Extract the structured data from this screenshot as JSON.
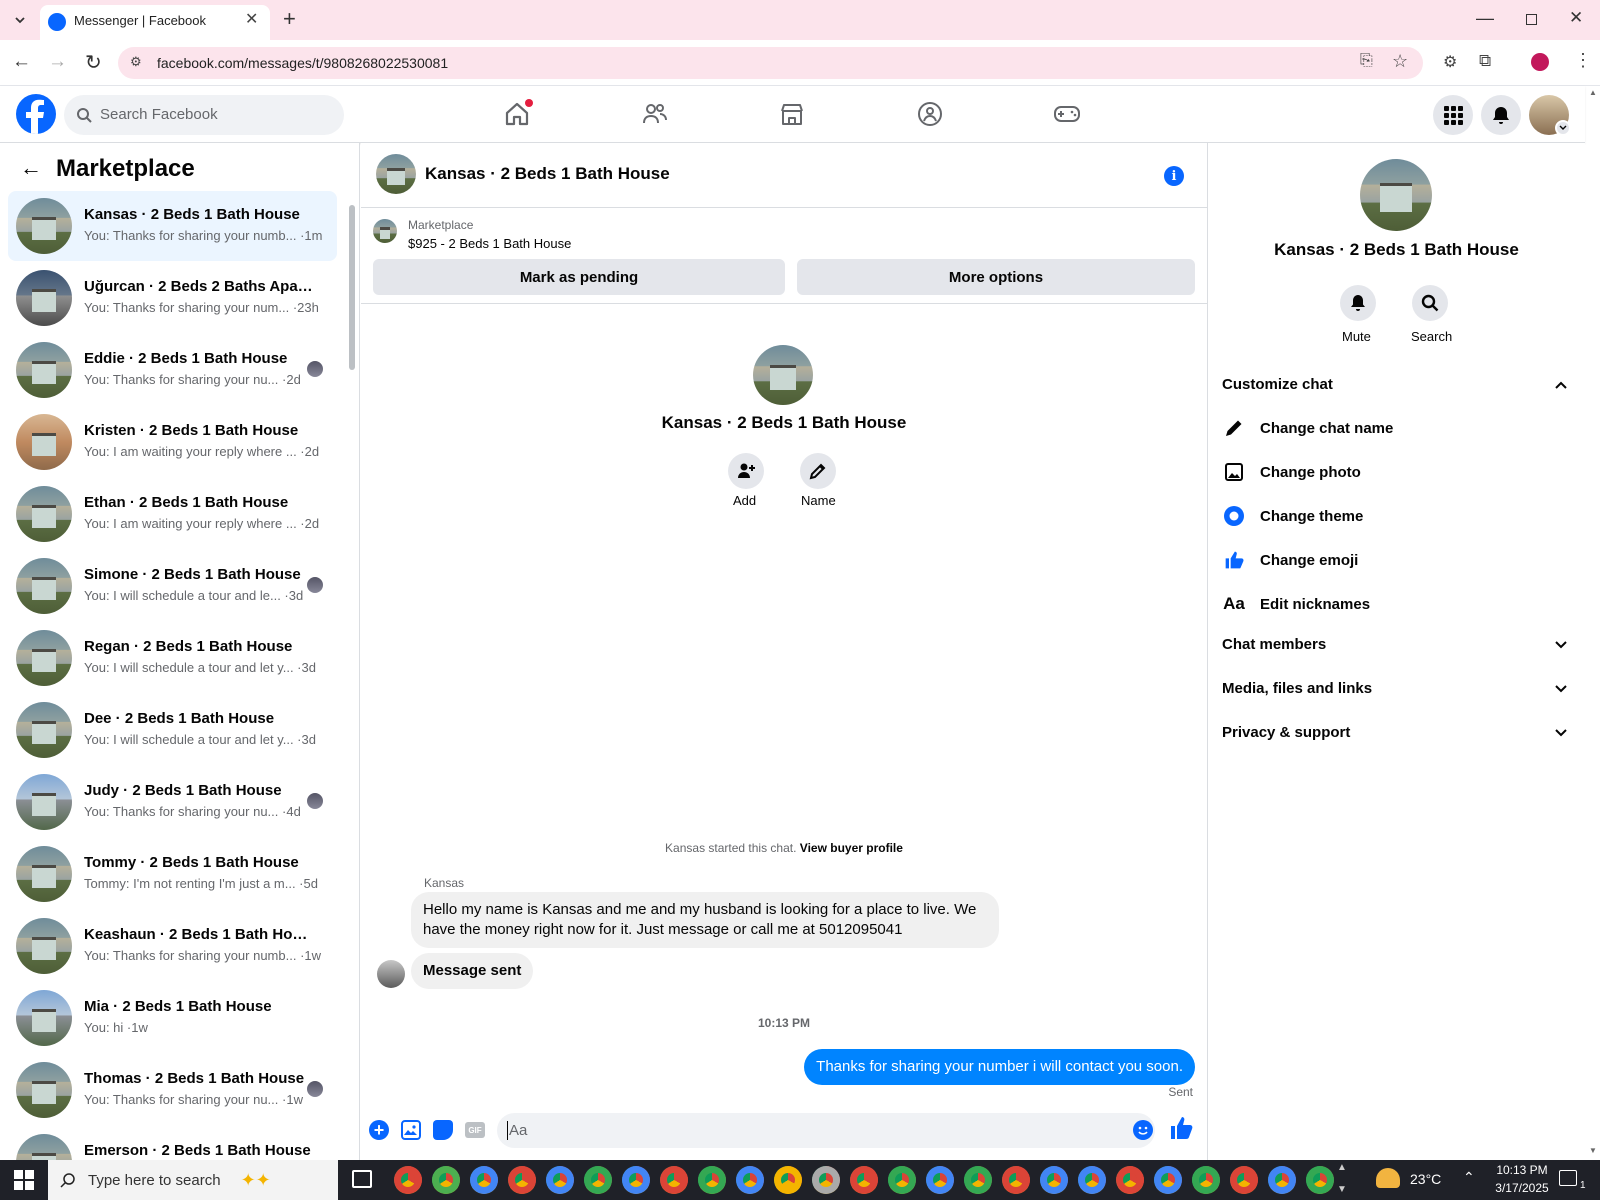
{
  "browser": {
    "tab_title": "Messenger | Facebook",
    "url": "facebook.com/messages/t/9808268022530081"
  },
  "fb": {
    "search_placeholder": "Search Facebook"
  },
  "left": {
    "title": "Marketplace",
    "conversations": [
      {
        "name": "Kansas · 2 Beds 1 Bath House",
        "preview": "You: Thanks for sharing your numb... ·1m",
        "active": true
      },
      {
        "name": "Uğurcan · 2 Beds 2 Baths Apart...",
        "preview": "You: Thanks for sharing your num... ·23h"
      },
      {
        "name": "Eddie · 2 Beds 1 Bath House",
        "preview": "You: Thanks for sharing your nu... ·2d"
      },
      {
        "name": "Kristen · 2 Beds 1 Bath House",
        "preview": "You: I am waiting your reply where ... ·2d"
      },
      {
        "name": "Ethan · 2 Beds 1 Bath House",
        "preview": "You: I am waiting your reply where ... ·2d"
      },
      {
        "name": "Simone · 2 Beds 1 Bath House",
        "preview": "You: I will schedule a tour and le... ·3d"
      },
      {
        "name": "Regan · 2 Beds 1 Bath House",
        "preview": "You: I will schedule a tour and let y... ·3d"
      },
      {
        "name": "Dee · 2 Beds 1 Bath House",
        "preview": "You: I will schedule a tour and let y... ·3d"
      },
      {
        "name": "Judy · 2 Beds 1 Bath House",
        "preview": "You: Thanks for sharing your nu... ·4d"
      },
      {
        "name": "Tommy · 2 Beds 1 Bath House",
        "preview": "Tommy: I'm not renting I'm just a m... ·5d"
      },
      {
        "name": "Keashaun · 2 Beds 1 Bath House",
        "preview": "You: Thanks for sharing your numb... ·1w"
      },
      {
        "name": "Mia · 2 Beds 1 Bath House",
        "preview": "You: hi ·1w"
      },
      {
        "name": "Thomas · 2 Beds 1 Bath House",
        "preview": "You: Thanks for sharing your nu... ·1w"
      },
      {
        "name": "Emerson · 2 Beds 1 Bath House",
        "preview": ""
      }
    ]
  },
  "chat": {
    "header_title": "Kansas · 2 Beds 1 Bath House",
    "listing_source": "Marketplace",
    "listing_title": "$925 - 2 Beds 1 Bath House",
    "mark_pending": "Mark as pending",
    "more_options": "More options",
    "intro_name": "Kansas · 2 Beds 1 Bath House",
    "add_label": "Add",
    "name_label": "Name",
    "started_text": "Kansas started this chat.",
    "view_buyer": "View buyer profile",
    "sender_name": "Kansas",
    "msg1": "Hello my name is Kansas and me and my husband is looking for a place to live. We have the money right now for it. Just message or call me at 5012095041",
    "msg2": "Message sent",
    "timestamp": "10:13 PM",
    "msg3": "Thanks for sharing your number i will contact you soon.",
    "status": "Sent",
    "composer_placeholder": "Aa",
    "gif_label": "GIF"
  },
  "right": {
    "title": "Kansas · 2 Beds 1 Bath House",
    "mute": "Mute",
    "search": "Search",
    "customize": "Customize chat",
    "change_name": "Change chat name",
    "change_photo": "Change photo",
    "change_theme": "Change theme",
    "change_emoji": "Change emoji",
    "edit_nicknames": "Edit nicknames",
    "nickname_glyph": "Aa",
    "chat_members": "Chat members",
    "media": "Media, files and links",
    "privacy": "Privacy & support"
  },
  "taskbar": {
    "search_placeholder": "Type here to search",
    "weather": "23°C",
    "time": "10:13 PM",
    "date": "3/17/2025",
    "notif_count": "1"
  },
  "colors": {
    "fb_blue": "#0866ff",
    "messenger_blue": "#0084ff",
    "tab_pink": "#fce4ec"
  }
}
